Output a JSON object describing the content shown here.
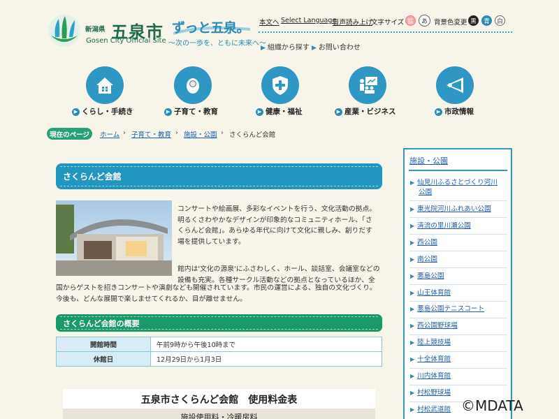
{
  "header": {
    "logo_small": "新潟県",
    "logo_big": "五泉市",
    "logo_en": "Gosen City Official Site",
    "slogan": "ずっと五泉。",
    "slogan_sub": "〜次の一歩を、ともに未来へ〜",
    "util": {
      "honbun": "本文へ",
      "language": "Select Language",
      "voice": "音声読み上げ",
      "font_size_label": "文字サイズ",
      "font_large": "拡",
      "font_normal": "あ",
      "color_label": "背景色変更",
      "color_black": "黒",
      "color_blue": "青",
      "color_white": "白"
    },
    "org_search": "組織から探す",
    "contact": "お問い合わせ"
  },
  "nav": [
    {
      "label": "くらし・手続き",
      "icon": "house-icon"
    },
    {
      "label": "子育て・教育",
      "icon": "baby-icon"
    },
    {
      "label": "健康・福祉",
      "icon": "health-shield-icon"
    },
    {
      "label": "産業・ビジネス",
      "icon": "presentation-icon"
    },
    {
      "label": "市政情報",
      "icon": "megaphone-icon"
    }
  ],
  "breadcrumb": {
    "tag": "現在のページ",
    "items": [
      "ホーム",
      "子育て・教育",
      "施設・公園",
      "さくらんど会館"
    ]
  },
  "main": {
    "title": "さくらんど会館",
    "intro": [
      "コンサートや絵画展、多彩なイベントを行う、文化活動の拠点。",
      "明るくさわやかなデザインが印象的なコミュニティホール、「さ",
      "くらんど会館」。あらゆる年代に向けて文化に親しみ、創りだす",
      "場を提供しています。"
    ],
    "detail": [
      "館内は'文化の源泉'にふさわしく、ホール、談話室、会議室などの",
      "設備も充実。各種サークル活動などの拠点となっているほか、全",
      "国からゲストを招きコンサートや演劇なども開催されています。市民の運営による、独自の文化づくり。",
      "今後も、どんな展開で楽しませてくれるか、目が離せません。"
    ],
    "overview_title": "さくらんど会館の概要",
    "overview": [
      {
        "label": "開館時間",
        "value": "午前9時から午後10時まで"
      },
      {
        "label": "休館日",
        "value": "12月29日から1月3日"
      }
    ],
    "fee_title": "五泉市さくらんど会館　使用料金表",
    "fee_sub": "施設使用料・冷暖房料"
  },
  "sidebar": {
    "heading": "施設・公園",
    "items": [
      "仙見川ふるさとづくり河川",
      "公園",
      "東光院河川ふれあい公園",
      "清流の里川瀬公園",
      "西公園",
      "南公園",
      "悪島公園",
      "山王体育館",
      "悪島公園テニスコート",
      "西公園野球場",
      "陸上競技場",
      "十全体育館",
      "川内体育館",
      "村松野球場",
      "村松武道館"
    ]
  },
  "watermark": "©MDATA",
  "colors": {
    "accent": "#2096c0",
    "green": "#1a9a6a",
    "link": "#1f5fa8",
    "background": "#f7f5ea"
  }
}
